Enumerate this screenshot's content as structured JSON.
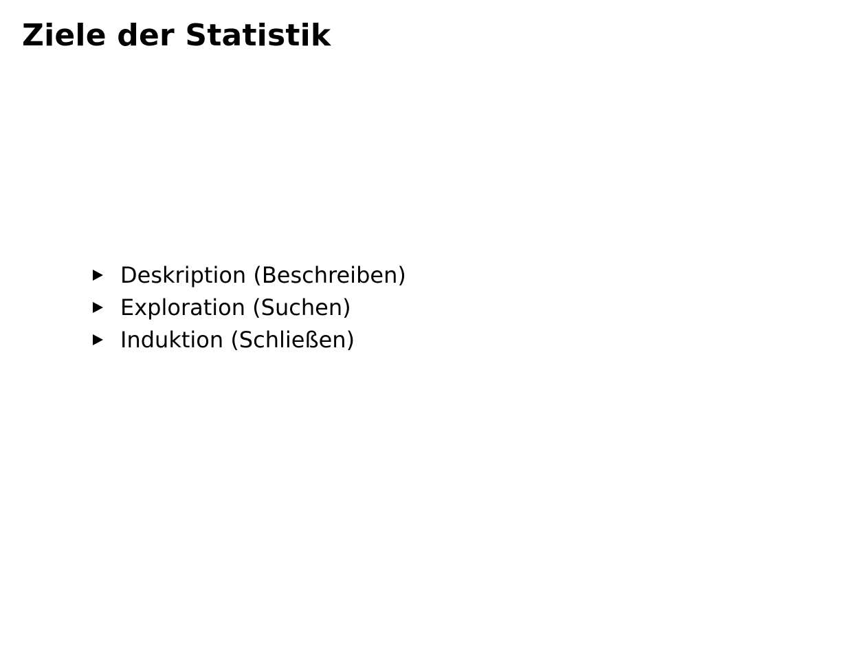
{
  "slide": {
    "title": "Ziele der Statistik",
    "bullets": [
      {
        "text": "Deskription (Beschreiben)"
      },
      {
        "text": "Exploration (Suchen)"
      },
      {
        "text": "Induktion (Schließen)"
      }
    ],
    "bullet_icon": "triangle-right-icon",
    "text_color": "#000000",
    "background_color": "#ffffff"
  }
}
